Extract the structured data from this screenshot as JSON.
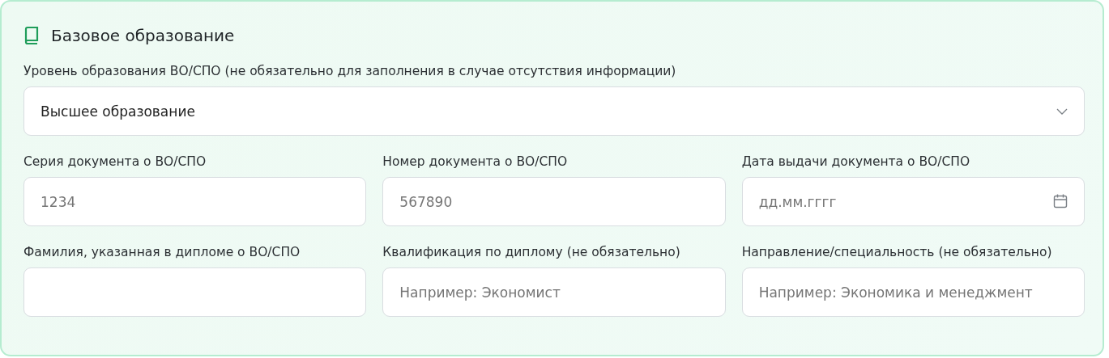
{
  "section": {
    "title": "Базовое образование"
  },
  "level_field": {
    "label": "Уровень образования ВО/СПО (не обязательно для заполнения в случае отсутствия информации)",
    "value": "Высшее образование"
  },
  "fields": [
    {
      "kind": "text",
      "label": "Серия документа о ВО/СПО",
      "placeholder": "1234"
    },
    {
      "kind": "text",
      "label": "Номер документа о ВО/СПО",
      "placeholder": "567890"
    },
    {
      "kind": "date",
      "label": "Дата выдачи документа о ВО/СПО",
      "placeholder": "дд.мм.гггг"
    },
    {
      "kind": "text",
      "label": "Фамилия, указанная в дипломе о ВО/СПО"
    },
    {
      "kind": "text",
      "label": "Квалификация по диплому (не обязательно)",
      "placeholder": "Например: Экономист"
    },
    {
      "kind": "text",
      "label": "Направление/специальность (не обязательно)",
      "placeholder": "Например: Экономика и менеджмент"
    }
  ]
}
